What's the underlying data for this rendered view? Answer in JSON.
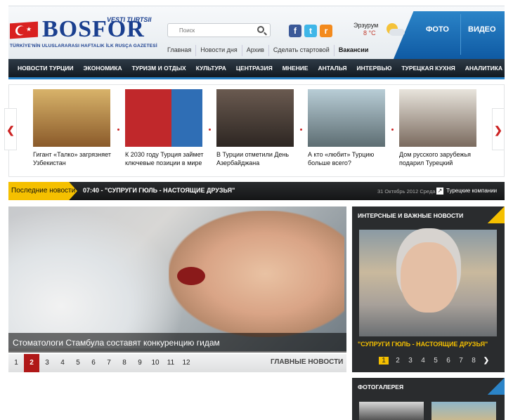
{
  "header": {
    "logo_text": "BOSFOR",
    "logo_sup": "VESTI TURTSII",
    "tagline": "TÜRKİYE'NİN ULUSLARARASI HAFTALIK İLK RUSÇA GAZETESİ",
    "search_placeholder": "Поиск",
    "top_nav": [
      "Главная",
      "Новости дня",
      "Архив",
      "Сделать стартовой",
      "Вакансии"
    ],
    "weather": {
      "city": "Эрзурум",
      "temp": "8 °C"
    },
    "media": {
      "photo": "ФОТО",
      "video": "ВИДЕО"
    },
    "social": {
      "facebook": "f",
      "twitter": "t",
      "rss": "r"
    }
  },
  "main_nav": [
    "НОВОСТИ ТУРЦИИ",
    "ЭКОНОМИКА",
    "ТУРИЗМ И ОТДЫХ",
    "КУЛЬТУРА",
    "ЦЕНТРАЗИЯ",
    "МНЕНИЕ",
    "АНТАЛЬЯ",
    "ИНТЕРВЬЮ",
    "ТУРЕЦКАЯ КУХНЯ",
    "АНАЛИТИКА"
  ],
  "carousel": {
    "items": [
      {
        "caption": "Гигант «Талко» загрязняет Узбекистан",
        "color": "#b27a3a"
      },
      {
        "caption": "К 2030 году Турция займет ключевые позиции в мире",
        "color": "#c0282b"
      },
      {
        "caption": "В Турции отметили День Азербайджана",
        "color": "#4a3a36"
      },
      {
        "caption": "А кто «любит» Турцию больше всего?",
        "color": "#8aa3ab"
      },
      {
        "caption": "Дом русского зарубежья подарил Турецкий",
        "color": "#c9c2b3"
      }
    ]
  },
  "ticker": {
    "label": "Последние новости",
    "time": "07:40",
    "headline": "\"СУПРУГИ ГЮЛЬ - НАСТОЯЩИЕ ДРУЗЬЯ\"",
    "date": "31 Октябрь 2012 Среда",
    "category": "Турецкие компании"
  },
  "main_story": {
    "caption": "Стоматологи Стамбула составят конкуренцию гидам",
    "pages": [
      "1",
      "2",
      "3",
      "4",
      "5",
      "6",
      "7",
      "8",
      "9",
      "10",
      "11",
      "12"
    ],
    "active_page": "2",
    "section_label": "ГЛАВНЫЕ НОВОСТИ"
  },
  "featured_box": {
    "title": "ИНТЕРСНЫЕ И ВАЖНЫЕ НОВОСТИ",
    "caption": "\"СУПРУГИ ГЮЛЬ - НАСТОЯЩИЕ ДРУЗЬЯ\"",
    "pages": [
      "1",
      "2",
      "3",
      "4",
      "5",
      "6",
      "7",
      "8"
    ],
    "active_page": "1",
    "next_label": "❯"
  },
  "gallery": {
    "title": "ФОТОГАЛЕРЕЯ"
  }
}
